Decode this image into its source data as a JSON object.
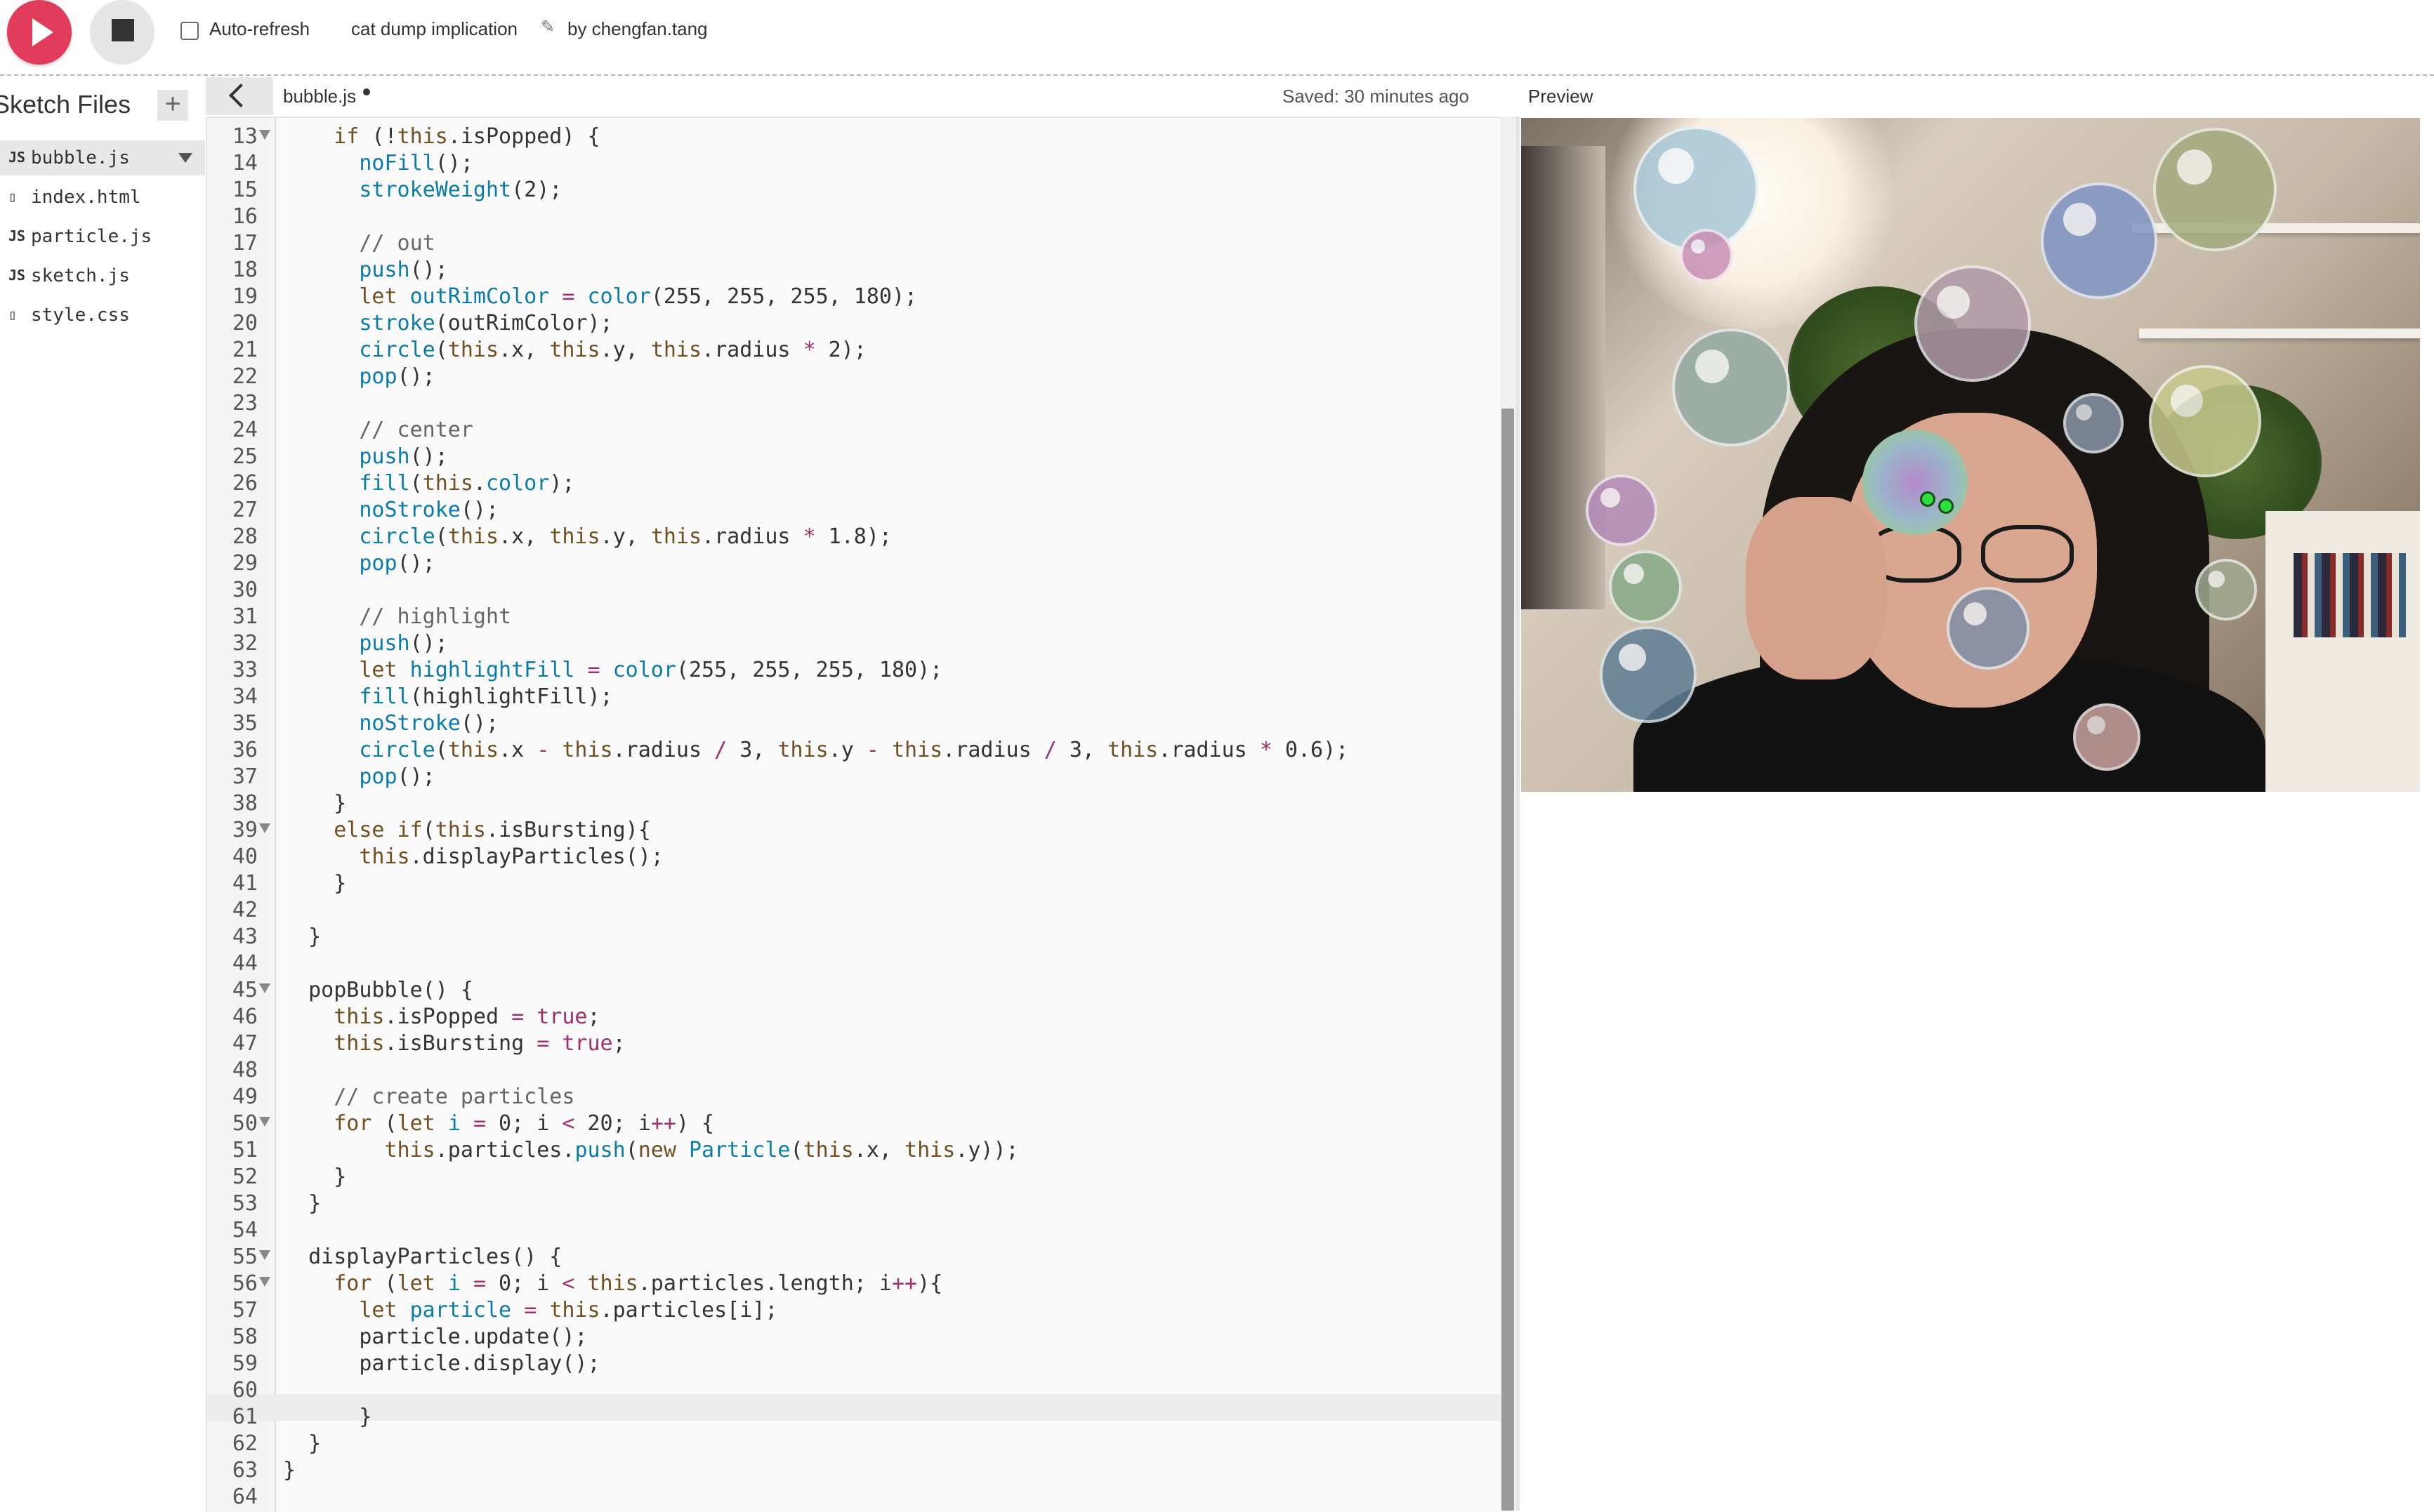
{
  "toolbar": {
    "auto_refresh_label": "Auto-refresh",
    "project_name": "cat dump implication",
    "author": "by chengfan.tang"
  },
  "sidebar": {
    "title": "Sketch Files",
    "files": [
      {
        "type": "JS",
        "name": "bubble.js",
        "active": true
      },
      {
        "type": "html",
        "name": "index.html",
        "active": false
      },
      {
        "type": "JS",
        "name": "particle.js",
        "active": false
      },
      {
        "type": "JS",
        "name": "sketch.js",
        "active": false
      },
      {
        "type": "css",
        "name": "style.css",
        "active": false
      }
    ]
  },
  "editor": {
    "tab_name": "bubble.js",
    "saved_status": "Saved: 30 minutes ago",
    "active_line": 61,
    "lines": [
      {
        "n": 13,
        "fold": true,
        "html": "    <span class=\"tk-kw\">if</span> (!<span class=\"tk-this\">this</span>.isPopped) {"
      },
      {
        "n": 14,
        "html": "      <span class=\"tk-fn\">noFill</span>();"
      },
      {
        "n": 15,
        "html": "      <span class=\"tk-fn\">strokeWeight</span>(2);"
      },
      {
        "n": 16,
        "html": ""
      },
      {
        "n": 17,
        "html": "      <span class=\"tk-cm\">// out</span>"
      },
      {
        "n": 18,
        "html": "      <span class=\"tk-fn\">push</span>();"
      },
      {
        "n": 19,
        "html": "      <span class=\"tk-kw\">let</span> <span class=\"tk-var\">outRimColor</span> <span class=\"tk-op\">=</span> <span class=\"tk-fn\">color</span>(255, 255, 255, 180);"
      },
      {
        "n": 20,
        "html": "      <span class=\"tk-fn\">stroke</span>(outRimColor);"
      },
      {
        "n": 21,
        "html": "      <span class=\"tk-fn\">circle</span>(<span class=\"tk-this\">this</span>.x, <span class=\"tk-this\">this</span>.y, <span class=\"tk-this\">this</span>.radius <span class=\"tk-op\">*</span> 2);"
      },
      {
        "n": 22,
        "html": "      <span class=\"tk-fn\">pop</span>();"
      },
      {
        "n": 23,
        "html": ""
      },
      {
        "n": 24,
        "html": "      <span class=\"tk-cm\">// center</span>"
      },
      {
        "n": 25,
        "html": "      <span class=\"tk-fn\">push</span>();"
      },
      {
        "n": 26,
        "html": "      <span class=\"tk-fn\">fill</span>(<span class=\"tk-this\">this</span>.<span class=\"tk-fn\">color</span>);"
      },
      {
        "n": 27,
        "html": "      <span class=\"tk-fn\">noStroke</span>();"
      },
      {
        "n": 28,
        "html": "      <span class=\"tk-fn\">circle</span>(<span class=\"tk-this\">this</span>.x, <span class=\"tk-this\">this</span>.y, <span class=\"tk-this\">this</span>.radius <span class=\"tk-op\">*</span> 1.8);"
      },
      {
        "n": 29,
        "html": "      <span class=\"tk-fn\">pop</span>();"
      },
      {
        "n": 30,
        "html": ""
      },
      {
        "n": 31,
        "html": "      <span class=\"tk-cm\">// highlight</span>"
      },
      {
        "n": 32,
        "html": "      <span class=\"tk-fn\">push</span>();"
      },
      {
        "n": 33,
        "html": "      <span class=\"tk-kw\">let</span> <span class=\"tk-var\">highlightFill</span> <span class=\"tk-op\">=</span> <span class=\"tk-fn\">color</span>(255, 255, 255, 180);"
      },
      {
        "n": 34,
        "html": "      <span class=\"tk-fn\">fill</span>(highlightFill);"
      },
      {
        "n": 35,
        "html": "      <span class=\"tk-fn\">noStroke</span>();"
      },
      {
        "n": 36,
        "html": "      <span class=\"tk-fn\">circle</span>(<span class=\"tk-this\">this</span>.x <span class=\"tk-op\">-</span> <span class=\"tk-this\">this</span>.radius <span class=\"tk-op\">/</span> 3, <span class=\"tk-this\">this</span>.y <span class=\"tk-op\">-</span> <span class=\"tk-this\">this</span>.radius <span class=\"tk-op\">/</span> 3, <span class=\"tk-this\">this</span>.radius <span class=\"tk-op\">*</span> 0.6);"
      },
      {
        "n": 37,
        "html": "      <span class=\"tk-fn\">pop</span>();"
      },
      {
        "n": 38,
        "html": "    }"
      },
      {
        "n": 39,
        "fold": true,
        "html": "    <span class=\"tk-kw\">else if</span>(<span class=\"tk-this\">this</span>.isBursting){"
      },
      {
        "n": 40,
        "html": "      <span class=\"tk-this\">this</span>.displayParticles();"
      },
      {
        "n": 41,
        "html": "    }"
      },
      {
        "n": 42,
        "html": ""
      },
      {
        "n": 43,
        "html": "  }"
      },
      {
        "n": 44,
        "html": ""
      },
      {
        "n": 45,
        "fold": true,
        "html": "  popBubble() {"
      },
      {
        "n": 46,
        "html": "    <span class=\"tk-this\">this</span>.isPopped <span class=\"tk-op\">=</span> <span class=\"tk-bool\">true</span>;"
      },
      {
        "n": 47,
        "html": "    <span class=\"tk-this\">this</span>.isBursting <span class=\"tk-op\">=</span> <span class=\"tk-bool\">true</span>;"
      },
      {
        "n": 48,
        "html": ""
      },
      {
        "n": 49,
        "html": "    <span class=\"tk-cm\">// create particles</span>"
      },
      {
        "n": 50,
        "fold": true,
        "html": "    <span class=\"tk-kw\">for</span> (<span class=\"tk-kw\">let</span> <span class=\"tk-var\">i</span> <span class=\"tk-op\">=</span> 0; i <span class=\"tk-op\">&lt;</span> 20; i<span class=\"tk-op\">++</span>) {"
      },
      {
        "n": 51,
        "html": "        <span class=\"tk-this\">this</span>.particles.<span class=\"tk-fn\">push</span>(<span class=\"tk-kw\">new</span> <span class=\"tk-cls\">Particle</span>(<span class=\"tk-this\">this</span>.x, <span class=\"tk-this\">this</span>.y));"
      },
      {
        "n": 52,
        "html": "    }"
      },
      {
        "n": 53,
        "html": "  }"
      },
      {
        "n": 54,
        "html": ""
      },
      {
        "n": 55,
        "fold": true,
        "html": "  displayParticles() {"
      },
      {
        "n": 56,
        "fold": true,
        "html": "    <span class=\"tk-kw\">for</span> (<span class=\"tk-kw\">let</span> <span class=\"tk-var\">i</span> <span class=\"tk-op\">=</span> 0; i <span class=\"tk-op\">&lt;</span> <span class=\"tk-this\">this</span>.particles.length; i<span class=\"tk-op\">++</span>){"
      },
      {
        "n": 57,
        "html": "      <span class=\"tk-kw\">let</span> <span class=\"tk-var\">particle</span> <span class=\"tk-op\">=</span> <span class=\"tk-this\">this</span>.particles[i];"
      },
      {
        "n": 58,
        "html": "      particle.update();"
      },
      {
        "n": 59,
        "html": "      particle.display();"
      },
      {
        "n": 60,
        "html": ""
      },
      {
        "n": 61,
        "html": "      }"
      },
      {
        "n": 62,
        "html": "  }"
      },
      {
        "n": 63,
        "html": "}"
      },
      {
        "n": 64,
        "html": ""
      }
    ]
  },
  "preview": {
    "label": "Preview",
    "bubble_colors": [
      "#a9c8d8",
      "#c990b5",
      "#b09aa8",
      "#8095c4",
      "#a3ab7e",
      "#93a9a2",
      "#8a96a8",
      "#b48ab8",
      "#88aa88",
      "#5f7f95",
      "#7f8fa8",
      "#c8cb8e",
      "#a0a890",
      "#c9a2a0"
    ]
  },
  "colors": {
    "run_button": "#e23c5c",
    "hand_point": "#2de03c"
  }
}
